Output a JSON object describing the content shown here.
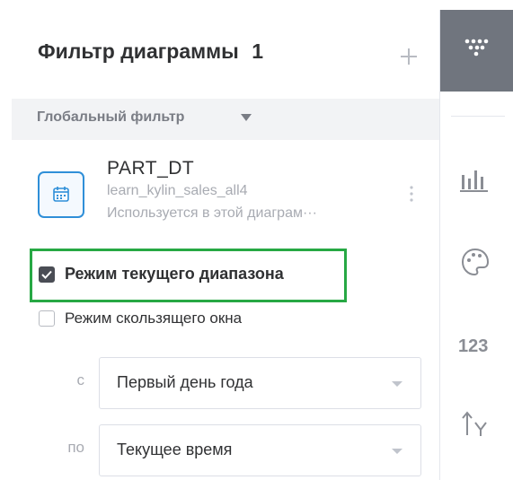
{
  "panel": {
    "title": "Фильтр диаграммы",
    "count": "1",
    "add_icon": "plus-icon"
  },
  "section": {
    "label": "Глобальный фильтр",
    "caret_icon": "caret-down-icon"
  },
  "field": {
    "icon": "calendar-icon",
    "name": "PART_DT",
    "table": "learn_kylin_sales_all4",
    "usage": "Используется в этой диаграм···",
    "more_icon": "more-vertical-icon"
  },
  "modes": {
    "current_range": {
      "label": "Режим текущего диапазона",
      "checked": true
    },
    "sliding_window": {
      "label": "Режим скользящего окна",
      "checked": false
    }
  },
  "range": {
    "from_label": "с",
    "from_value": "Первый день года",
    "to_label": "по",
    "to_value": "Текущее время"
  },
  "toolbar": {
    "items": [
      {
        "icon": "filter-funnel-icon",
        "active": true
      },
      {
        "icon": "bar-chart-icon"
      },
      {
        "icon": "palette-icon"
      },
      {
        "icon": "number-format-icon",
        "text": "123"
      },
      {
        "icon": "sort-y-axis-icon"
      }
    ]
  },
  "colors": {
    "accent_blue": "#2f8fd8",
    "highlight_green": "#27a844",
    "toolbar_active": "#70757e"
  }
}
